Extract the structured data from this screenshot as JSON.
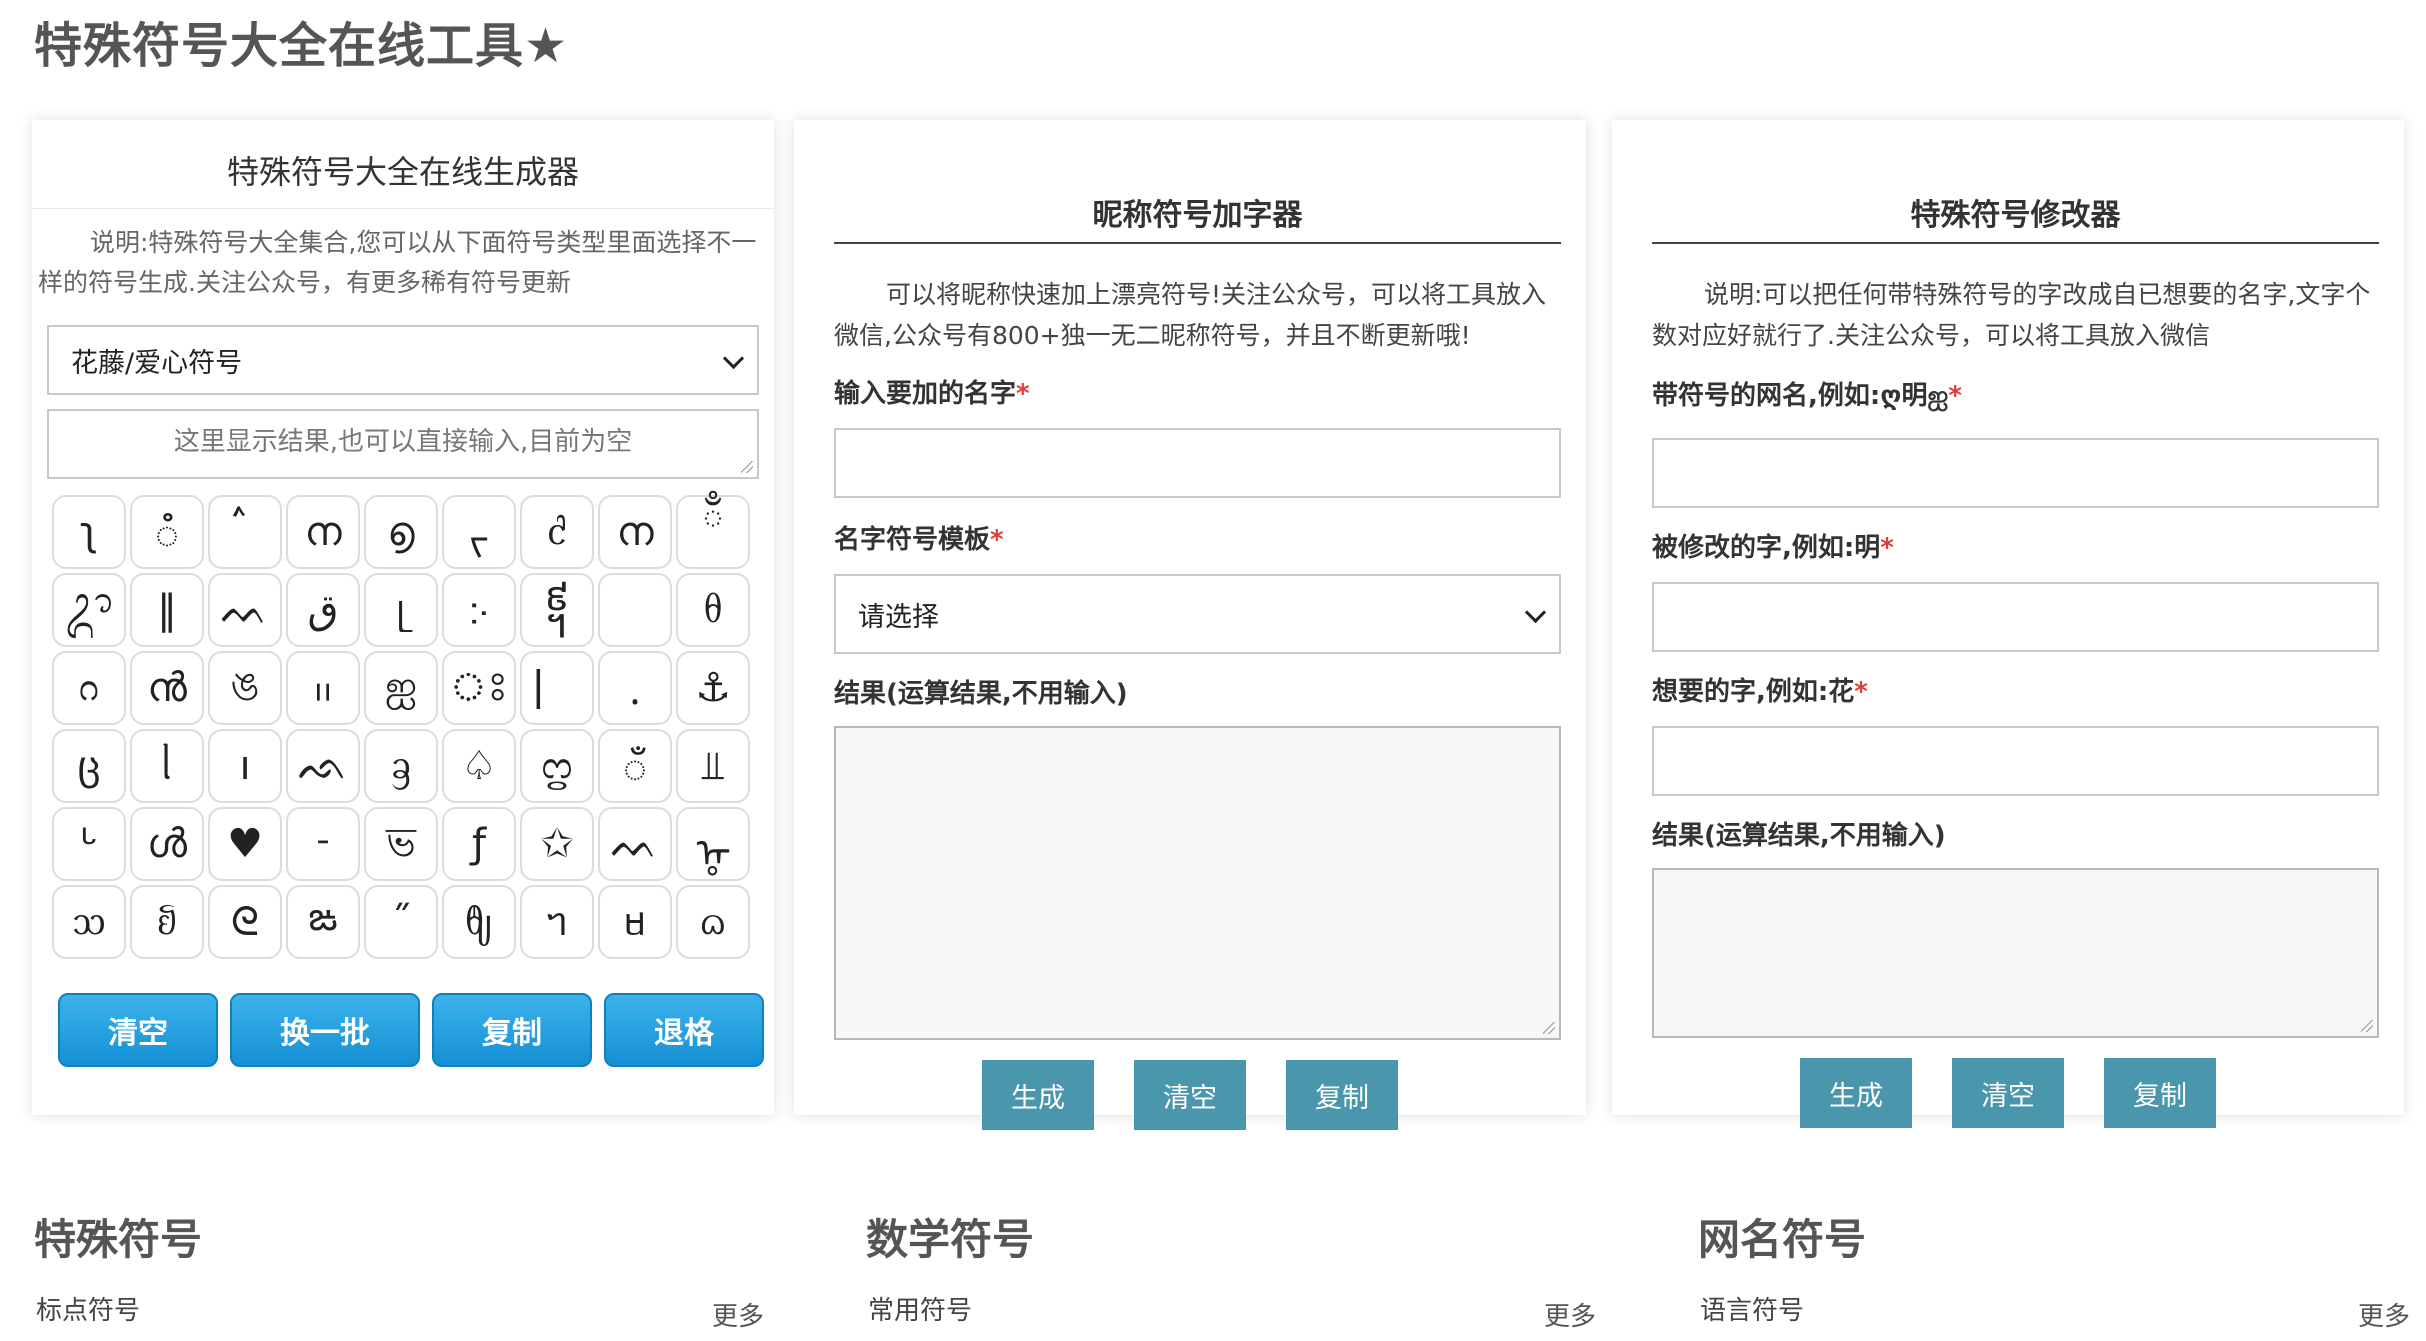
{
  "page": {
    "title": "特殊符号大全在线工具★"
  },
  "generator": {
    "title": "特殊符号大全在线生成器",
    "description": "说明:特殊符号大全集合,您可以从下面符号类型里面选择不一样的符号生成.关注公众号，有更多稀有符号更新",
    "category_selected": "花藤/爱心符号",
    "output_placeholder": "这里显示结果,也可以直接输入,目前为空",
    "symbols": [
      "ʅ",
      "ꠋ",
      "ࠦ",
      "ന",
      "൭",
      "ᡕ",
      "ᦺ",
      "ന",
      "ྃ",
      "ᬊ",
      "‖",
      "ᨓ",
      "ق",
      "ᥨ",
      "჻",
      "᧩",
      "",
      "ᦲ",
      "ᦅ",
      "ൻ",
      "ঙ",
      "᱿",
      "ஐ",
      "ঃ",
      "⎸",
      "ᱹ",
      "⚓",
      "ც",
      "ᥣ",
      "ı",
      "ᨒ",
      "ᦃ",
      "♤",
      "ᦦ",
      "ँ",
      "⫫",
      "ᒡ",
      "ൾ",
      "♥",
      "ᱼ",
      "ভ",
      "ƒ",
      "✩",
      "ᨓ",
      "ᡎ",
      "ᦉ",
      "ᦚ",
      "ᘓ",
      "ఙ",
      "˝",
      "ᦿ",
      "ᥐ",
      "ᥛ",
      "ᦒ"
    ],
    "buttons": {
      "clear": "清空",
      "refresh": "换一批",
      "copy": "复制",
      "backspace": "退格"
    }
  },
  "nickname_tool": {
    "title": "昵称符号加字器",
    "description": "可以将昵称快速加上漂亮符号!关注公众号，可以将工具放入微信,公众号有800+独一无二昵称符号，并且不断更新哦!",
    "name_label": "输入要加的名字",
    "template_label": "名字符号模板",
    "template_selected": "请选择",
    "result_label": "结果(运算结果,不用输入)",
    "buttons": {
      "generate": "生成",
      "clear": "清空",
      "copy": "复制"
    }
  },
  "modifier_tool": {
    "title": "特殊符号修改器",
    "description": "说明:可以把任何带特殊符号的字改成自已想要的名字,文字个数对应好就行了.关注公众号，可以将工具放入微信",
    "symbol_name_label": "带符号的网名,例如:ღ明ஐ",
    "modified_char_label": "被修改的字,例如:明",
    "desired_char_label": "想要的字,例如:花",
    "result_label": "结果(运算结果,不用输入)",
    "buttons": {
      "generate": "生成",
      "clear": "清空",
      "copy": "复制"
    }
  },
  "sections": [
    {
      "title": "特殊符号",
      "sub": "标点符号",
      "more": "更多"
    },
    {
      "title": "数学符号",
      "sub": "常用符号",
      "more": "更多"
    },
    {
      "title": "网名符号",
      "sub": "语言符号",
      "more": "更多"
    }
  ],
  "colors": {
    "blue_button": "#1a97da",
    "teal_button": "#4a96ad",
    "required": "#e23a3a"
  }
}
